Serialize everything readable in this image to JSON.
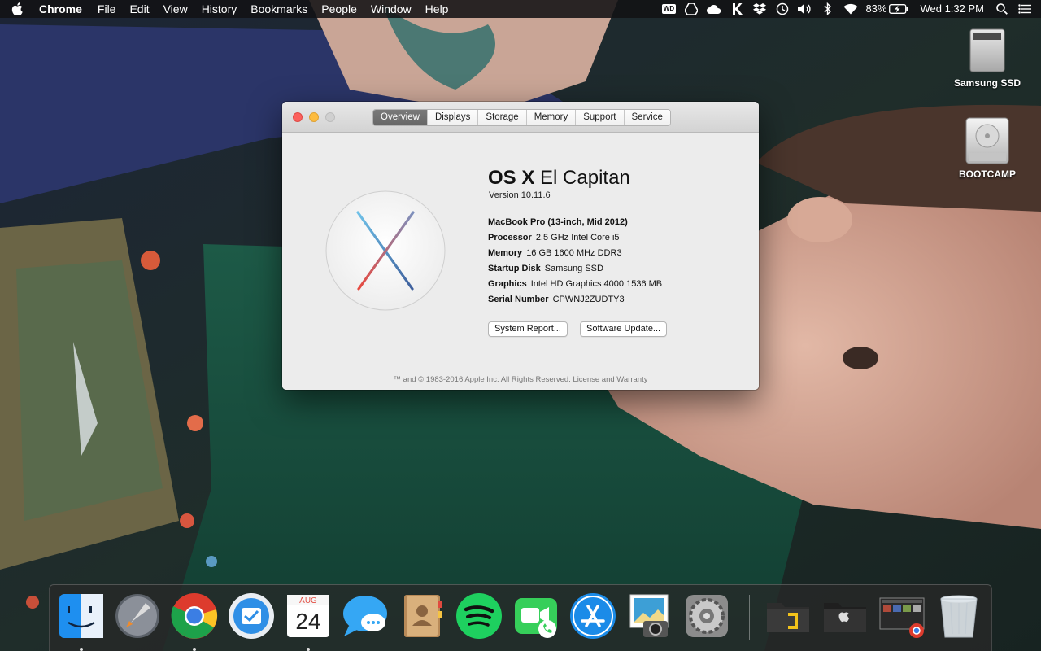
{
  "menubar": {
    "app_name": "Chrome",
    "menus": [
      "File",
      "Edit",
      "View",
      "History",
      "Bookmarks",
      "People",
      "Window",
      "Help"
    ],
    "battery_percent": "83%",
    "clock": "Wed 1:32 PM",
    "wd_label": "WD"
  },
  "desktop_icons": [
    {
      "label": "Samsung SSD"
    },
    {
      "label": "BOOTCAMP"
    }
  ],
  "about_window": {
    "tabs": [
      {
        "label": "Overview",
        "active": true
      },
      {
        "label": "Displays"
      },
      {
        "label": "Storage"
      },
      {
        "label": "Memory"
      },
      {
        "label": "Support"
      },
      {
        "label": "Service"
      }
    ],
    "os_name_bold": "OS X",
    "os_name_rest": "El Capitan",
    "version": "Version 10.11.6",
    "model": "MacBook Pro (13-inch, Mid 2012)",
    "specs": [
      {
        "label": "Processor",
        "value": "2.5 GHz Intel Core i5"
      },
      {
        "label": "Memory",
        "value": "16 GB 1600 MHz DDR3"
      },
      {
        "label": "Startup Disk",
        "value": "Samsung SSD"
      },
      {
        "label": "Graphics",
        "value": "Intel HD Graphics 4000 1536 MB"
      },
      {
        "label": "Serial Number",
        "value": "CPWNJ2ZUDTY3"
      }
    ],
    "buttons": {
      "system_report": "System Report...",
      "software_update": "Software Update..."
    },
    "footer": "™ and © 1983-2016 Apple Inc. All Rights Reserved. License and Warranty"
  },
  "dock": {
    "calendar_month": "AUG",
    "calendar_day": "24",
    "items": [
      {
        "name": "Finder",
        "icon": "finder-icon",
        "running": true
      },
      {
        "name": "Launchpad",
        "icon": "launchpad-icon",
        "running": false
      },
      {
        "name": "Chrome",
        "icon": "chrome-icon",
        "running": true
      },
      {
        "name": "Wunderlist",
        "icon": "checklist-icon",
        "running": false
      },
      {
        "name": "Calendar",
        "icon": "calendar-icon",
        "running": true
      },
      {
        "name": "Messages",
        "icon": "messages-icon",
        "running": false
      },
      {
        "name": "Contacts",
        "icon": "contacts-icon",
        "running": false
      },
      {
        "name": "Spotify",
        "icon": "spotify-icon",
        "running": false
      },
      {
        "name": "FaceTime",
        "icon": "facetime-icon",
        "running": false
      },
      {
        "name": "App Store",
        "icon": "app-store-icon",
        "running": false
      },
      {
        "name": "Preview",
        "icon": "preview-icon",
        "running": false
      },
      {
        "name": "System Preferences",
        "icon": "system-preferences-icon",
        "running": false
      },
      {
        "name": "Applications folder",
        "icon": "folder-icon",
        "running": false
      },
      {
        "name": "Apple folder",
        "icon": "folder-icon",
        "running": false
      },
      {
        "name": "Chrome window",
        "icon": "window-thumbnail-icon",
        "running": false
      },
      {
        "name": "Trash",
        "icon": "trash-icon",
        "running": false
      }
    ]
  },
  "colors": {
    "menubar_bg": "#121214",
    "window_bg": "#ececec",
    "close": "#fc605c",
    "minimize": "#fdbc40",
    "active_tab": "#6e6e6e"
  }
}
